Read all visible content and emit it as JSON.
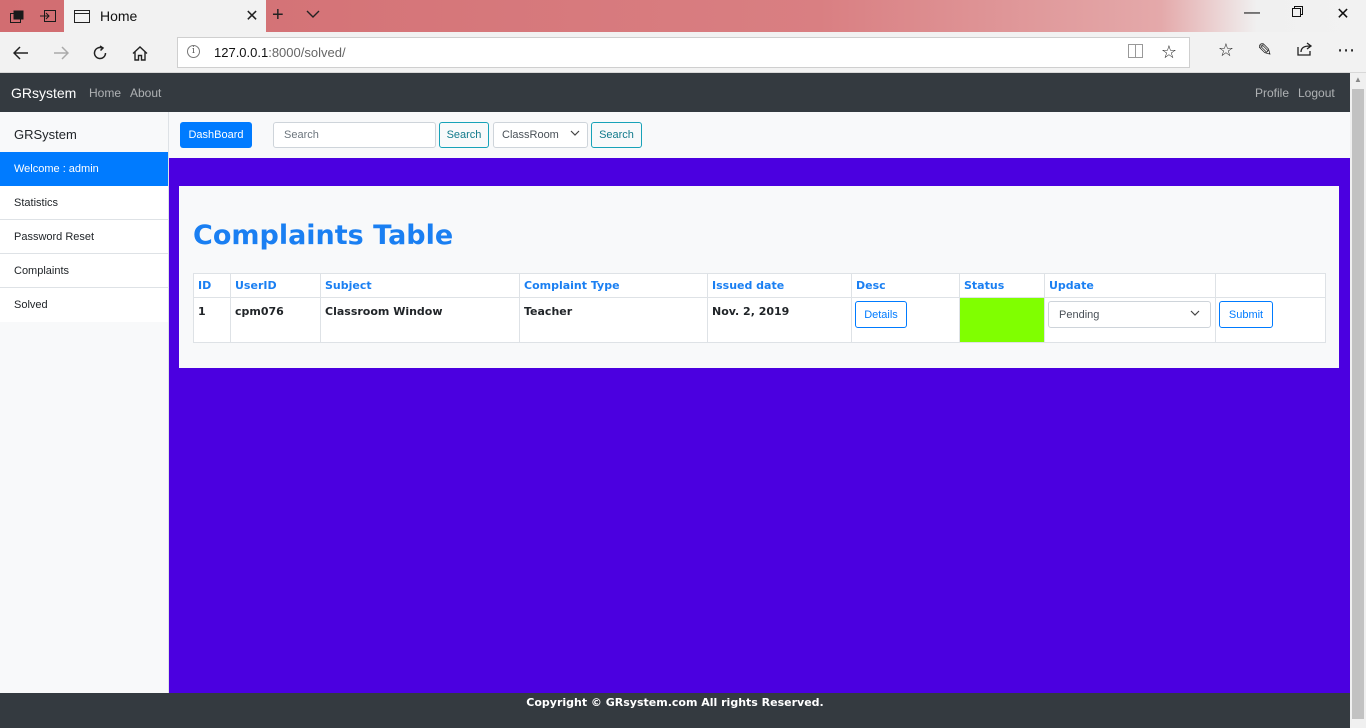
{
  "browser": {
    "tab_title": "Home",
    "url_host": "127.0.0.1",
    "url_rest": ":8000/solved/"
  },
  "topnav": {
    "brand": "GRsystem",
    "links": [
      "Home",
      "About"
    ],
    "right_links": [
      "Profile",
      "Logout"
    ]
  },
  "sidebar": {
    "heading": "GRSystem",
    "items": [
      "Welcome : admin",
      "Statistics",
      "Password Reset",
      "Complaints",
      "Solved"
    ]
  },
  "toolbar": {
    "dashboard_label": "DashBoard",
    "search_placeholder": "Search",
    "search_button": "Search",
    "filter_value": "ClassRoom",
    "filter_button": "Search"
  },
  "main": {
    "title": "Complaints Table",
    "headers": [
      "ID",
      "UserID",
      "Subject",
      "Complaint Type",
      "Issued date",
      "Desc",
      "Status",
      "Update"
    ],
    "rows": [
      {
        "id": "1",
        "user_id": "cpm076",
        "subject": "Classroom Window",
        "type": "Teacher",
        "issued": "Nov. 2, 2019",
        "desc_button": "Details",
        "status_color": "#80ff00",
        "update_value": "Pending",
        "submit_button": "Submit"
      }
    ]
  },
  "footer": {
    "text": "Copyright © GRsystem.com All rights Reserved."
  },
  "colors": {
    "main_background": "#4b00e0",
    "primary": "#007bff",
    "title": "#1a7ff2",
    "navbar": "#343a40"
  }
}
